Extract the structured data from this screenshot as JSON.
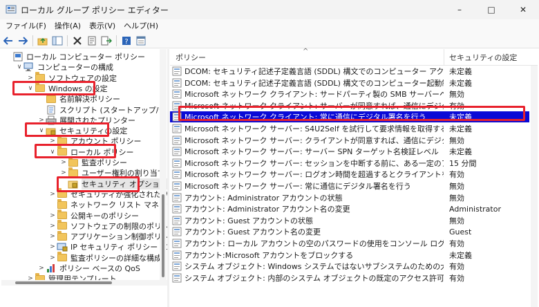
{
  "window": {
    "title": "ローカル グループ ポリシー エディター",
    "controls": {
      "minimize": "–",
      "maximize": "□",
      "close": "✕"
    }
  },
  "menu": [
    "ファイル(F)",
    "操作(A)",
    "表示(V)",
    "ヘルプ(H)"
  ],
  "toolbar": {
    "icons": [
      "back-arrow-icon",
      "forward-arrow-icon",
      "folder-up-icon",
      "show-hide-tree-icon",
      "delete-icon",
      "properties-icon",
      "export-list-icon",
      "help-icon",
      "view-icon"
    ]
  },
  "tree": [
    {
      "label": "ローカル コンピューター ポリシー",
      "depth": 0,
      "twisty": "",
      "icon": "computer-icon"
    },
    {
      "label": "コンピューターの構成",
      "depth": 1,
      "twisty": "∨",
      "icon": "computer-config-icon"
    },
    {
      "label": "ソフトウェアの設定",
      "depth": 2,
      "twisty": ">",
      "icon": "folder-icon"
    },
    {
      "label": "Windows の設定",
      "depth": 2,
      "twisty": "∨",
      "icon": "folder-icon"
    },
    {
      "label": "名前解決ポリシー",
      "depth": 3,
      "twisty": "",
      "icon": "folder-icon"
    },
    {
      "label": "スクリプト (スタートアップ/シャットダウン)",
      "depth": 3,
      "twisty": "",
      "icon": "script-icon"
    },
    {
      "label": "展開されたプリンター",
      "depth": 3,
      "twisty": ">",
      "icon": "printer-icon"
    },
    {
      "label": "セキュリティの設定",
      "depth": 3,
      "twisty": "∨",
      "icon": "security-settings-icon"
    },
    {
      "label": "アカウント ポリシー",
      "depth": 4,
      "twisty": ">",
      "icon": "folder-icon"
    },
    {
      "label": "ローカル ポリシー",
      "depth": 4,
      "twisty": "∨",
      "icon": "folder-icon"
    },
    {
      "label": "監査ポリシー",
      "depth": 5,
      "twisty": ">",
      "icon": "folder-icon"
    },
    {
      "label": "ユーザー権利の割り当て",
      "depth": 5,
      "twisty": ">",
      "icon": "folder-icon"
    },
    {
      "label": "セキュリティ オプション",
      "depth": 5,
      "twisty": "",
      "icon": "folder-open-icon"
    },
    {
      "label": "セキュリティが強化された Windows",
      "depth": 4,
      "twisty": ">",
      "icon": "folder-icon"
    },
    {
      "label": "ネットワーク リスト マネージャー ポリ",
      "depth": 4,
      "twisty": "",
      "icon": "folder-icon"
    },
    {
      "label": "公開キーのポリシー",
      "depth": 4,
      "twisty": ">",
      "icon": "folder-icon"
    },
    {
      "label": "ソフトウェアの制限のポリシー",
      "depth": 4,
      "twisty": ">",
      "icon": "folder-icon"
    },
    {
      "label": "アプリケーション制御ポリシー",
      "depth": 4,
      "twisty": ">",
      "icon": "folder-icon"
    },
    {
      "label": "IP セキュリティ ポリシー (ローカル コ",
      "depth": 4,
      "twisty": ">",
      "icon": "ip-security-icon"
    },
    {
      "label": "監査ポリシーの詳細な構成",
      "depth": 4,
      "twisty": ">",
      "icon": "folder-icon"
    },
    {
      "label": "ポリシー ベースの QoS",
      "depth": 3,
      "twisty": ">",
      "icon": "qos-chart-icon"
    },
    {
      "label": "管理用テンプレート",
      "depth": 2,
      "twisty": ">",
      "icon": "folder-icon"
    }
  ],
  "list": {
    "columns": {
      "policy": "ポリシー",
      "setting": "セキュリティの設定"
    },
    "rows": [
      {
        "name": "DCOM: セキュリティ記述子定義言語 (SDDL) 構文でのコンピューター アクセス制限",
        "setting": "未定義"
      },
      {
        "name": "DCOM: セキュリティ記述子定義言語 (SDDL) 構文でのコンピューター起動制限",
        "setting": "未定義"
      },
      {
        "name": "Microsoft ネットワーク クライアント: サードパーティ製の SMB サーバーへのパスワードを、暗号...",
        "setting": "無効"
      },
      {
        "name": "Microsoft ネットワーク クライアント: サーバーが同意すれば、通信にデジタル署名を行う",
        "setting": "有効"
      },
      {
        "name": "Microsoft ネットワーク クライアント: 常に通信にデジタル署名を行う",
        "setting": "未定義"
      },
      {
        "name": "Microsoft ネットワーク サーバー: S4U2Self を試行して要求情報を取得する",
        "setting": "未定義"
      },
      {
        "name": "Microsoft ネットワーク サーバー: クライアントが同意すれば、通信にデジタル署名を行う",
        "setting": "無効"
      },
      {
        "name": "Microsoft ネットワーク サーバー: サーバー SPN ターゲット名検証レベル",
        "setting": "未定義"
      },
      {
        "name": "Microsoft ネットワーク サーバー: セッションを中断する前に、ある一定のアイドル時間を必要...",
        "setting": "15 分間"
      },
      {
        "name": "Microsoft ネットワーク サーバー: ログオン時間を超過するとクライアントを切断する",
        "setting": "有効"
      },
      {
        "name": "Microsoft ネットワーク サーバー: 常に通信にデジタル署名を行う",
        "setting": "無効"
      },
      {
        "name": "アカウント: Administrator アカウントの状態",
        "setting": "無効"
      },
      {
        "name": "アカウント: Administrator アカウント名の変更",
        "setting": "Administrator"
      },
      {
        "name": "アカウント: Guest アカウントの状態",
        "setting": "無効"
      },
      {
        "name": "アカウント: Guest アカウント名の変更",
        "setting": "Guest"
      },
      {
        "name": "アカウント: ローカル アカウントの空のパスワードの使用をコンソール ログオンのみに制限する",
        "setting": "有効"
      },
      {
        "name": "アカウント:Microsoft アカウントをブロックする",
        "setting": "未定義"
      },
      {
        "name": "システム オブジェクト: Windows システムではないサブシステムのための大文字と小文字の区...",
        "setting": "有効"
      },
      {
        "name": "システム オブジェクト: 内部のシステム オブジェクトの既定のアクセス許可を強化する (例: シン...",
        "setting": "有効"
      }
    ]
  },
  "colors": {
    "highlight": "#e8212c",
    "selection": "#0a0ad6"
  }
}
